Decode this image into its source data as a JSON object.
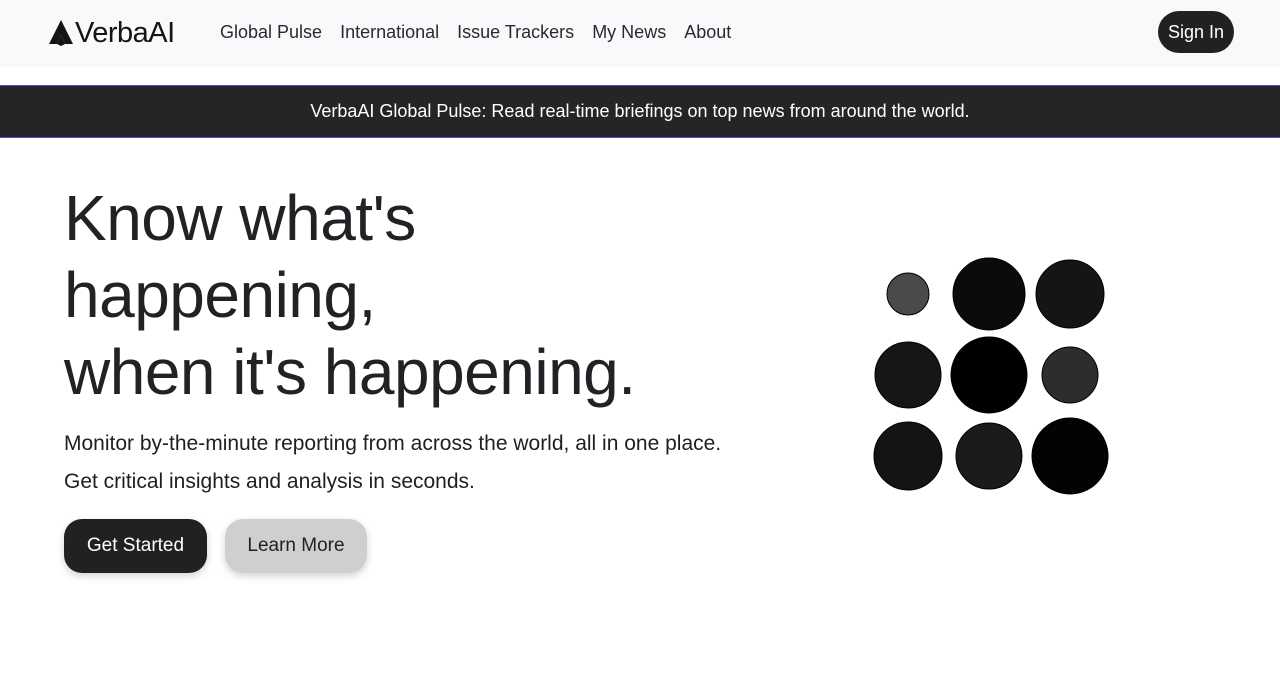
{
  "nav": {
    "brand": "VerbaAI",
    "links": [
      "Global Pulse",
      "International",
      "Issue Trackers",
      "My News",
      "About"
    ],
    "sign_in": "Sign In"
  },
  "announcement": "VerbaAI Global Pulse: Read real-time briefings on top news from around the world.",
  "hero": {
    "title_lines": [
      "Know what's",
      "happening,",
      "when it's happening."
    ],
    "subtitle": "Monitor by-the-minute reporting from across the world, all in one place. Get critical insights and analysis in seconds.",
    "primary_button": "Get Started",
    "secondary_button": "Learn More"
  },
  "graphic": {
    "dot_colors": [
      "#4a4a4c",
      "#0b0b0c",
      "#151516",
      "#161617",
      "#000000",
      "#2d2d2f",
      "#141415",
      "#1b1b1c",
      "#030303"
    ]
  },
  "colors": {
    "nav_bg": "#f8f9fa",
    "dark": "#212124",
    "banner_bg": "#252527",
    "secondary_btn": "#cfcfd0"
  }
}
